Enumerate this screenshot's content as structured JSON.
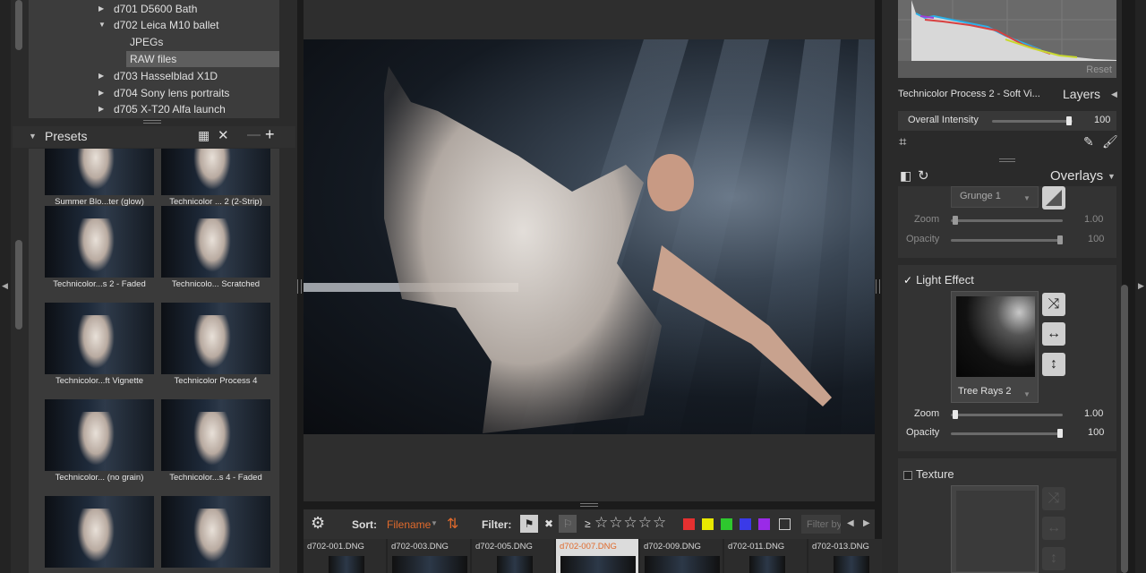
{
  "folders": [
    {
      "label": "d701 D5600 Bath",
      "expanded": false
    },
    {
      "label": "d702 Leica M10 ballet",
      "expanded": true
    },
    {
      "label": "JPEGs",
      "child": true
    },
    {
      "label": "RAW files",
      "child": true,
      "selected": true
    },
    {
      "label": "d703 Hasselblad X1D",
      "expanded": false
    },
    {
      "label": "d704 Sony lens portraits",
      "expanded": false
    },
    {
      "label": "d705 X-T20 Alfa launch",
      "expanded": false
    }
  ],
  "presets": {
    "title": "Presets",
    "items": [
      "Summer Blo...ter (glow)",
      "Technicolor ... 2 (2-Strip)",
      "Technicolor...s 2 - Faded",
      "Technicolo... Scratched",
      "Technicolor...ft Vignette",
      "Technicolor Process 4",
      "Technicolor... (no grain)",
      "Technicolor...s 4 - Faded",
      "",
      ""
    ]
  },
  "sortbar": {
    "sort_label": "Sort:",
    "sort_value": "Filename",
    "filter_label": "Filter:",
    "rating_prefix": "≥",
    "stars": "☆☆☆☆☆",
    "color_filters": [
      "#e53030",
      "#e8e800",
      "#2ec82e",
      "#3a3ae8",
      "#9a2ae8"
    ],
    "filter_placeholder": "Filter by"
  },
  "filmstrip": [
    {
      "name": "d702-001.DNG"
    },
    {
      "name": "d702-003.DNG"
    },
    {
      "name": "d702-005.DNG"
    },
    {
      "name": "d702-007.DNG",
      "active": true
    },
    {
      "name": "d702-009.DNG"
    },
    {
      "name": "d702-011.DNG"
    },
    {
      "name": "d702-013.DNG"
    }
  ],
  "right": {
    "hist_reset": "Reset",
    "layer_name": "Technicolor Process 2 - Soft Vi...",
    "layers_title": "Layers",
    "overall_label": "Overall Intensity",
    "overall_value": "100",
    "overall_level": 0.95,
    "overlays_title": "Overlays",
    "grunge_select": "Grunge  1",
    "grunge_zoom_label": "Zoom",
    "grunge_zoom_value": "1.00",
    "grunge_opacity_label": "Opacity",
    "grunge_opacity_value": "100",
    "light_title": "Light Effect",
    "light_checked": true,
    "light_select": "Tree Rays 2",
    "light_zoom_label": "Zoom",
    "light_zoom_value": "1.00",
    "light_opacity_label": "Opacity",
    "light_opacity_value": "100",
    "texture_title": "Texture",
    "texture_checked": false
  },
  "colors": {
    "accent": "#e06a2c",
    "panel": "#2a2a2a"
  }
}
